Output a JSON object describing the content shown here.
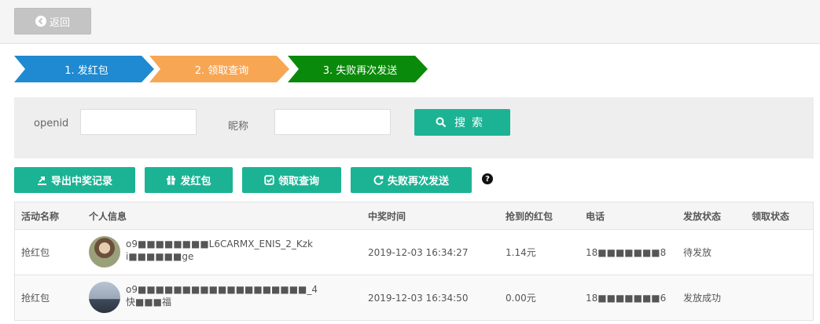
{
  "topbar": {
    "back_label": "返回"
  },
  "steps": [
    "1. 发红包",
    "2. 领取查询",
    "3. 失败再次发送"
  ],
  "colors": {
    "step1": "#1f8ad1",
    "step2": "#f7a654",
    "step3": "#0a8a0a",
    "accent": "#1cb394"
  },
  "search": {
    "openid_label": "openid",
    "nickname_label": "昵称",
    "openid_value": "",
    "nickname_value": "",
    "button_label": "搜索"
  },
  "actions": {
    "export": "导出中奖记录",
    "send": "发红包",
    "query": "领取查询",
    "resend": "失败再次发送"
  },
  "table": {
    "headers": [
      "活动名称",
      "个人信息",
      "中奖时间",
      "抢到的红包",
      "电话",
      "发放状态",
      "领取状态"
    ],
    "rows": [
      {
        "activity": "抢红包",
        "openid": "o9■■■■■■■■L6CARMX_ENIS_2_Kzk",
        "nickname": "i■■■■■■ge",
        "time": "2019-12-03 16:34:27",
        "amount": "1.14元",
        "phone": "18■■■■■■■8",
        "send_status": "待发放",
        "receive_status": ""
      },
      {
        "activity": "抢红包",
        "openid": "o9■■■■■■■■■■■■■■■■■■■_4",
        "nickname": "快■■■福",
        "time": "2019-12-03 16:34:50",
        "amount": "0.00元",
        "phone": "18■■■■■■■6",
        "send_status": "发放成功",
        "receive_status": ""
      }
    ]
  }
}
